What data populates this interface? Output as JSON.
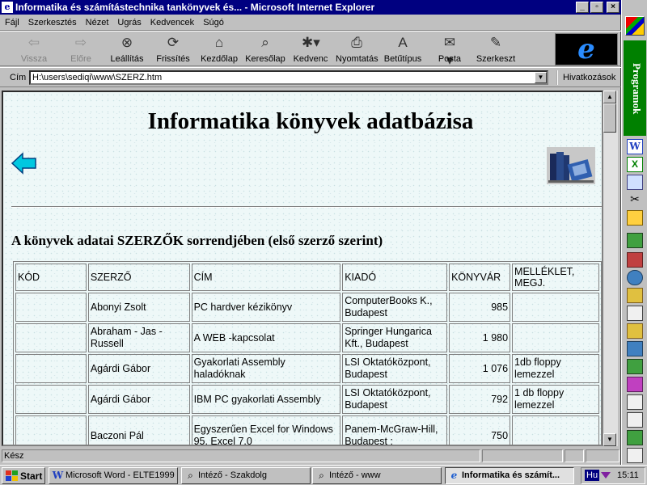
{
  "window": {
    "title": "Informatika és számítástechnika tankönyvek és... - Microsoft Internet Explorer",
    "minimize_glyph": "_",
    "maximize_glyph": "▫",
    "close_glyph": "×"
  },
  "menu": [
    "Fájl",
    "Szerkesztés",
    "Nézet",
    "Ugrás",
    "Kedvencek",
    "Súgó"
  ],
  "toolbar": {
    "back": "Vissza",
    "forward": "Előre",
    "stop": "Leállítás",
    "refresh": "Frissítés",
    "home": "Kezdőlap",
    "search": "Keresőlap",
    "favorites": "Kedvenc",
    "print": "Nyomtatás",
    "font": "Betűtípus",
    "mail": "Posta",
    "edit": "Szerkeszt"
  },
  "address": {
    "label": "Cím",
    "value": "H:\\users\\sediqi\\www\\SZERZ.htm",
    "links": "Hivatkozások"
  },
  "page": {
    "title": "Informatika könyvek adatbázisa",
    "subtitle": "A könyvek adatai SZERZŐK sorrendjében (első szerző szerint)"
  },
  "table": {
    "headers": [
      "KÓD",
      "SZERZŐ",
      "CÍM",
      "KIADÓ",
      "KÖNYVÁR",
      "MELLÉKLET, MEGJ."
    ],
    "rows": [
      {
        "kod": "",
        "szerzo": "Abonyi Zsolt",
        "cim": "PC hardver kézikönyv",
        "kiado": "ComputerBooks K., Budapest",
        "ar": "985",
        "megj": ""
      },
      {
        "kod": "",
        "szerzo": "Abraham - Jas - Russell",
        "cim": "A WEB -kapcsolat",
        "kiado": "Springer Hungarica Kft., Budapest",
        "ar": "1 980",
        "megj": ""
      },
      {
        "kod": "",
        "szerzo": "Agárdi Gábor",
        "cim": "Gyakorlati Assembly haladóknak",
        "kiado": "LSI Oktatóközpont, Budapest",
        "ar": "1 076",
        "megj": "1db floppy lemezzel"
      },
      {
        "kod": "",
        "szerzo": "Agárdi Gábor",
        "cim": "IBM PC gyakorlati Assembly",
        "kiado": "LSI Oktatóközpont, Budapest",
        "ar": "792",
        "megj": "1 db floppy lemezzel"
      },
      {
        "kod": "",
        "szerzo": "Baczoni Pál",
        "cim": "Egyszerűen Excel for Windows 95, Excel 7.0",
        "kiado": "Panem-McGraw-Hill, Budapest :",
        "ar": "750",
        "megj": ""
      }
    ]
  },
  "status": {
    "text": "Kész"
  },
  "office_bar": {
    "group_label": "Programok"
  },
  "taskbar": {
    "start": "Start",
    "tasks": [
      "Microsoft Word - ELTE1999",
      "Intéző - Szakdolg",
      "Intéző - www",
      "Informatika és számít..."
    ],
    "tray_lang": "Hu",
    "clock": "15:11"
  }
}
